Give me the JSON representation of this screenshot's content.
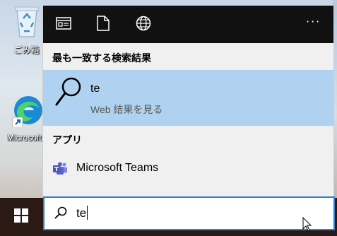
{
  "desktop": {
    "icons": [
      {
        "label": "ごみ箱",
        "icon": "recycle-bin-icon"
      },
      {
        "label": "Microsoft Edge",
        "icon": "edge-icon"
      }
    ]
  },
  "taskbar": {
    "start_icon": "windows-logo-icon"
  },
  "panel": {
    "header": {
      "icons": [
        "apps-icon",
        "documents-icon",
        "web-icon"
      ],
      "more_label": "···"
    },
    "best_match": {
      "title": "最も一致する検索結果",
      "item_title": "te",
      "item_subtitle": "Web 結果を見る",
      "icon": "search-icon"
    },
    "apps": {
      "title": "アプリ",
      "items": [
        {
          "name": "Microsoft Teams",
          "icon": "teams-icon"
        }
      ]
    }
  },
  "search": {
    "value": "te",
    "icon": "search-icon"
  },
  "colors": {
    "accent": "#2f7fd6",
    "highlight": "#aed2ef",
    "header": "#111111",
    "taskbar": "#2b1a14",
    "teams": "#5b5fc7"
  }
}
